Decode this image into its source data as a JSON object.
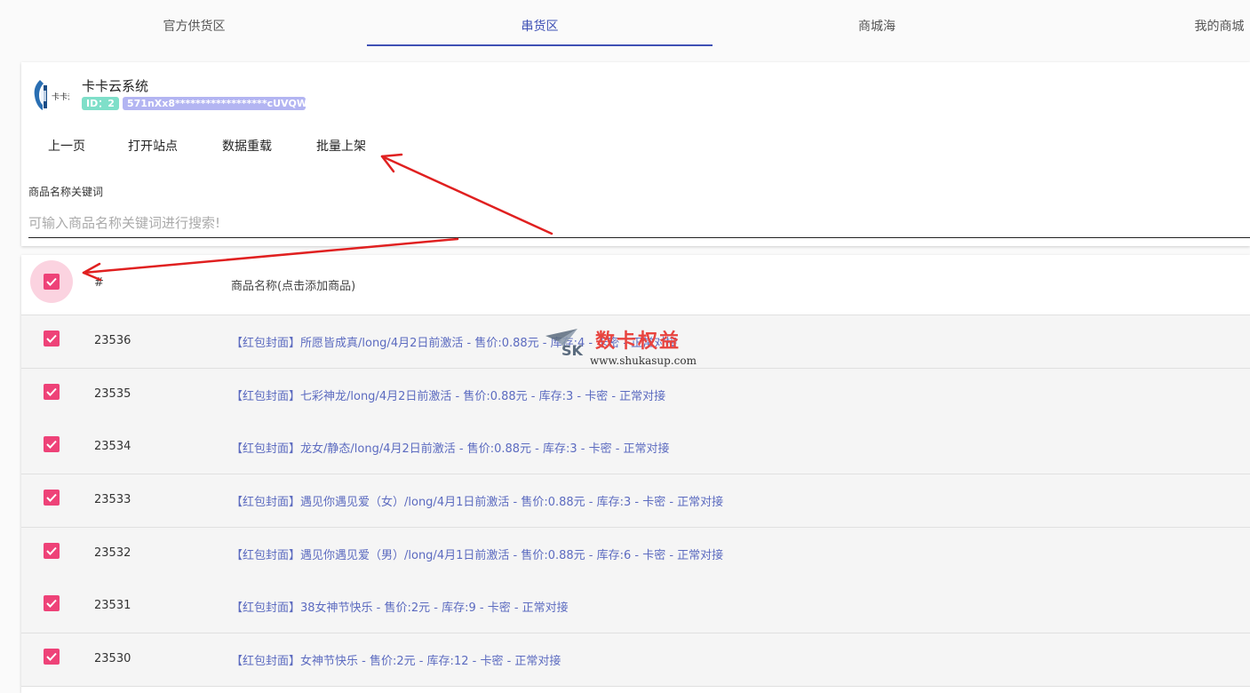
{
  "tabs": [
    {
      "label": "官方供货区"
    },
    {
      "label": "串货区"
    },
    {
      "label": "商城海"
    },
    {
      "label": "我的商城"
    }
  ],
  "active_tab_index": 1,
  "store": {
    "name": "卡卡云系统",
    "id_badge": "ID：2",
    "key_badge": "571nXx8******************cUVQWoh",
    "logo_text": "卡卡云"
  },
  "actions": {
    "prev_page": "上一页",
    "open_site": "打开站点",
    "reload_data": "数据重载",
    "batch_list": "批量上架"
  },
  "search": {
    "label": "商品名称关键词",
    "placeholder": "可输入商品名称关键词进行搜索!",
    "value": ""
  },
  "table": {
    "select_all_checked": true,
    "headers": {
      "id": "#",
      "name": "商品名称(点击添加商品)"
    },
    "rows": [
      {
        "checked": true,
        "id": "23536",
        "name": "【红包封面】所愿皆成真/long/4月2日前激活 - 售价:0.88元 - 库存:4 - 卡密 - 正常对接"
      },
      {
        "checked": true,
        "id": "23535",
        "name": "【红包封面】七彩神龙/long/4月2日前激活 - 售价:0.88元 - 库存:3 - 卡密 - 正常对接"
      },
      {
        "checked": true,
        "id": "23534",
        "name": "【红包封面】龙女/静态/long/4月2日前激活 - 售价:0.88元 - 库存:3 - 卡密 - 正常对接"
      },
      {
        "checked": true,
        "id": "23533",
        "name": "【红包封面】遇见你遇见爱（女）/long/4月1日前激活 - 售价:0.88元 - 库存:3 - 卡密 - 正常对接"
      },
      {
        "checked": true,
        "id": "23532",
        "name": "【红包封面】遇见你遇见爱（男）/long/4月1日前激活 - 售价:0.88元 - 库存:6 - 卡密 - 正常对接"
      },
      {
        "checked": true,
        "id": "23531",
        "name": "【红包封面】38女神节快乐 - 售价:2元 - 库存:9 - 卡密 - 正常对接"
      },
      {
        "checked": true,
        "id": "23530",
        "name": "【红包封面】女神节快乐 - 售价:2元 - 库存:12 - 卡密 - 正常对接"
      }
    ]
  },
  "watermark": {
    "brand": "数卡权益",
    "url": "www.shukasup.com",
    "mark": "SK"
  },
  "colors": {
    "accent": "#3f51b5",
    "checkbox": "#ee4278",
    "link": "#5c6bc0",
    "annotation_arrow": "#e02020"
  }
}
